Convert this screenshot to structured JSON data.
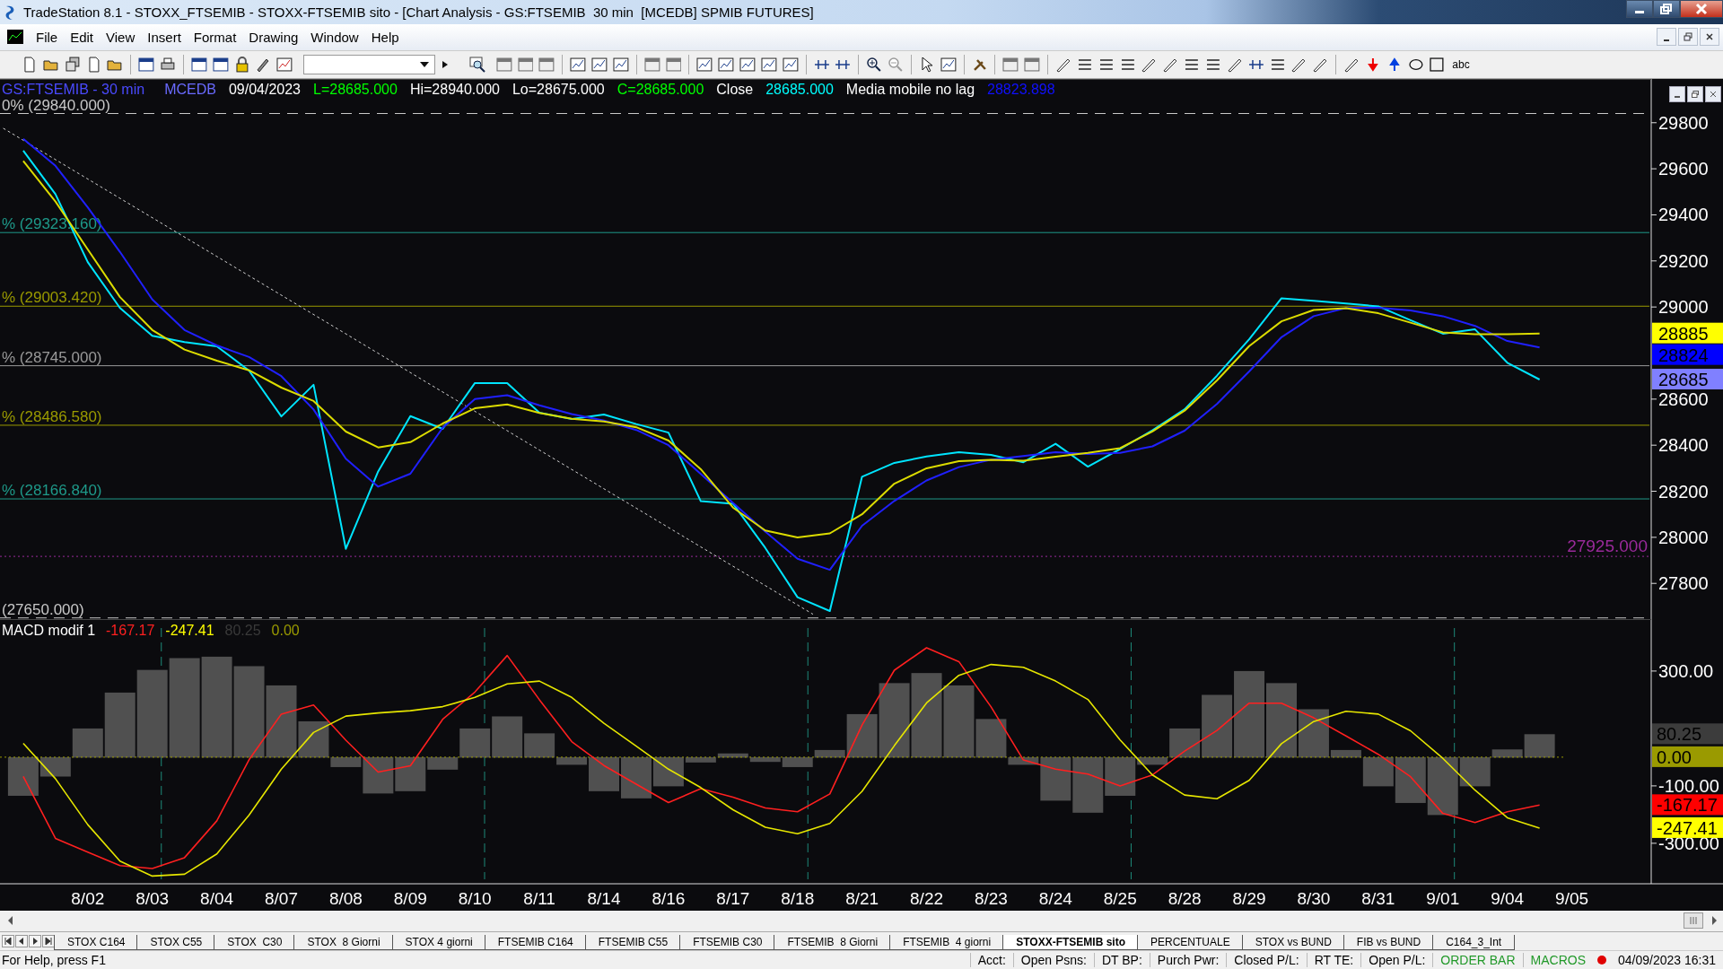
{
  "window": {
    "title": "TradeStation 8.1 - STOXX_FTSEMIB - STOXX-FTSEMIB sito - [Chart Analysis - GS:FTSEMIB  30 min  [MCEDB] SPMIB FUTURES]"
  },
  "menu": [
    "File",
    "Edit",
    "View",
    "Insert",
    "Format",
    "Drawing",
    "Window",
    "Help"
  ],
  "toolbar": {
    "text_tool": "abc"
  },
  "price_panel": {
    "header": [
      {
        "text": "GS:FTSEMIB - 30 min",
        "color": "#4a4aff"
      },
      {
        "text": "MCEDB",
        "color": "#6a6aff"
      },
      {
        "text": "09/04/2023",
        "color": "#ffffff"
      },
      {
        "text": "L=28685.000",
        "color": "#00ff00"
      },
      {
        "text": "Hi=28940.000",
        "color": "#ffffff"
      },
      {
        "text": "Lo=28675.000",
        "color": "#ffffff"
      },
      {
        "text": "C=28685.000",
        "color": "#00ff00"
      },
      {
        "text": "Close",
        "color": "#ffffff"
      },
      {
        "text": "28685.000",
        "color": "#00ffff"
      },
      {
        "text": "Media mobile no lag",
        "color": "#ffffff"
      },
      {
        "text": "28823.898",
        "color": "#1010ff"
      }
    ],
    "axis_badges": [
      {
        "label": "28885",
        "color": "#ffff00"
      },
      {
        "label": "28824",
        "color": "#0000ff"
      },
      {
        "label": "28685",
        "color": "#8080ff"
      }
    ],
    "chart_data": {
      "type": "line",
      "ylim": [
        27645,
        29990
      ],
      "yticks": [
        27800,
        28000,
        28200,
        28400,
        28600,
        29000,
        29200,
        29400,
        29600,
        29800
      ],
      "series": [
        {
          "color": "#00e5ff",
          "values": [
            29679,
            29490,
            29195,
            28996,
            28875,
            28848,
            28829,
            28724,
            28525,
            28662,
            27950,
            28286,
            28526,
            28471,
            28670,
            28670,
            28541,
            28514,
            28533,
            28492,
            28455,
            28157,
            28146,
            27954,
            27740,
            27680,
            28263,
            28323,
            28351,
            28370,
            28358,
            28326,
            28406,
            28307,
            28383,
            28465,
            28556,
            28702,
            28860,
            29038,
            29027,
            29015,
            29003,
            28943,
            28884,
            28903,
            28758,
            28685,
            null
          ]
        },
        {
          "color": "#2020ff",
          "values": [
            29730,
            29613,
            29432,
            29239,
            29033,
            28900,
            28833,
            28783,
            28700,
            28555,
            28341,
            28220,
            28276,
            28476,
            28600,
            28617,
            28573,
            28535,
            28507,
            28466,
            28400,
            28275,
            28150,
            28025,
            27907,
            27859,
            28050,
            28158,
            28247,
            28305,
            28337,
            28353,
            28370,
            28362,
            28367,
            28395,
            28463,
            28579,
            28720,
            28869,
            28960,
            28995,
            28997,
            28985,
            28960,
            28918,
            28852,
            28824,
            null
          ]
        },
        {
          "color": "#dcdc00",
          "values": [
            29634,
            29458,
            29250,
            29043,
            28900,
            28815,
            28767,
            28725,
            28650,
            28592,
            28459,
            28390,
            28413,
            28494,
            28560,
            28577,
            28540,
            28515,
            28503,
            28478,
            28420,
            28296,
            28129,
            28030,
            28000,
            28017,
            28100,
            28233,
            28300,
            28330,
            28337,
            28333,
            28350,
            28367,
            28387,
            28460,
            28550,
            28681,
            28830,
            28938,
            28987,
            28995,
            28973,
            28932,
            28890,
            28882,
            28882,
            28885,
            null
          ]
        }
      ],
      "ref_lines": [
        {
          "axis": "y",
          "value": 29840,
          "label": "0% (29840.000)",
          "color": "#c8c8c8"
        },
        {
          "axis": "y",
          "value": 29323.16,
          "label": "% (29323.160)",
          "color": "#1e9a8a"
        },
        {
          "axis": "y",
          "value": 29003.42,
          "label": "% (29003.420)",
          "color": "#9a9a00"
        },
        {
          "axis": "y",
          "value": 28745,
          "label": "% (28745.000)",
          "color": "#9a9a9a"
        },
        {
          "axis": "y",
          "value": 28486.58,
          "label": "% (28486.580)",
          "color": "#9a9a00"
        },
        {
          "axis": "y",
          "value": 28166.84,
          "label": "% (28166.840)",
          "color": "#1e9a8a"
        },
        {
          "axis": "y",
          "value": 27650,
          "label": "(27650.000)",
          "color": "#c8c8c8"
        },
        {
          "axis": "y",
          "value": 27925,
          "label": "27925.000",
          "color": "#9a2a9a"
        }
      ]
    }
  },
  "macd_panel": {
    "header": [
      {
        "text": "MACD modif 1",
        "color": "#ffffff"
      },
      {
        "text": "-167.17",
        "color": "#ff2020"
      },
      {
        "text": "-247.41",
        "color": "#ffff00"
      },
      {
        "text": "80.25",
        "color": "#3a3a3a"
      },
      {
        "text": "0.00",
        "color": "#9a9a00"
      }
    ],
    "axis_badges": [
      {
        "label": "80.25",
        "color": "#3c3c3c"
      },
      {
        "label": "0.00",
        "color": "#9a9a00"
      },
      {
        "label": "-167.17",
        "color": "#ff0000"
      },
      {
        "label": "-247.41",
        "color": "#ffff00"
      }
    ],
    "chart_data": {
      "type": "line",
      "ylim": [
        -441,
        481
      ],
      "categories": [
        null,
        null,
        "8/02",
        null,
        "8/03",
        null,
        "8/04",
        null,
        "8/07",
        null,
        "8/08",
        null,
        "8/09",
        null,
        "8/10",
        null,
        "8/11",
        null,
        "8/14",
        null,
        "8/16",
        null,
        "8/17",
        null,
        "8/18",
        null,
        "8/21",
        null,
        "8/22",
        null,
        "8/23",
        null,
        "8/24",
        null,
        "8/25",
        null,
        "8/28",
        null,
        "8/29",
        null,
        "8/30",
        null,
        "8/31",
        null,
        "9/01",
        null,
        "9/04",
        null,
        "9/05"
      ],
      "yticks": [
        {
          "value": 300,
          "label": "300.00"
        },
        {
          "value": -100,
          "label": "-100.00"
        },
        {
          "value": -300,
          "label": "-300.00"
        }
      ],
      "series": [
        {
          "type": "bar",
          "color": "#505050",
          "values": [
            -133,
            -66,
            100,
            225,
            304,
            345,
            350,
            317,
            250,
            125,
            -33,
            -125,
            -117,
            -42,
            100,
            142,
            83,
            -25,
            -117,
            -142,
            -100,
            -17,
            13,
            -15,
            -33,
            25,
            150,
            258,
            293,
            250,
            133,
            -25,
            -150,
            -192,
            -133,
            -25,
            100,
            217,
            300,
            258,
            167,
            25,
            -100,
            -158,
            -200,
            -100,
            27,
            80,
            null
          ]
        },
        {
          "type": "line",
          "color": "#ff2020",
          "values": [
            -67,
            -283,
            -331,
            -378,
            -388,
            -350,
            -222,
            -9,
            150,
            182,
            59,
            -52,
            -30,
            132,
            227,
            354,
            200,
            54,
            -29,
            -94,
            -158,
            -110,
            -139,
            -177,
            -190,
            -128,
            112,
            303,
            381,
            333,
            175,
            -10,
            -42,
            -59,
            -100,
            -62,
            21,
            93,
            188,
            188,
            137,
            74,
            10,
            -68,
            -196,
            -228,
            -190,
            -167,
            null
          ]
        },
        {
          "type": "line",
          "color": "#e6e600",
          "values": [
            48,
            -75,
            -235,
            -362,
            -414,
            -408,
            -337,
            -202,
            -42,
            86,
            143,
            154,
            162,
            176,
            208,
            255,
            265,
            208,
            118,
            38,
            -42,
            -106,
            -183,
            -244,
            -267,
            -231,
            -119,
            40,
            189,
            285,
            323,
            313,
            265,
            201,
            60,
            -62,
            -132,
            -145,
            -81,
            47,
            124,
            160,
            150,
            92,
            -4,
            -115,
            -211,
            -247,
            null
          ]
        }
      ],
      "ref_lines": [
        {
          "axis": "y",
          "value": 0,
          "color": "#9a9a00"
        }
      ]
    }
  },
  "sheet_tabs": [
    {
      "label": "STOX C164",
      "selected": false
    },
    {
      "label": "STOX C55",
      "selected": false
    },
    {
      "label": "STOX  C30",
      "selected": false
    },
    {
      "label": "STOX  8 Giorni",
      "selected": false
    },
    {
      "label": "STOX 4 giorni",
      "selected": false
    },
    {
      "label": "FTSEMIB C164",
      "selected": false
    },
    {
      "label": "FTSEMIB C55",
      "selected": false
    },
    {
      "label": "FTSEMIB C30",
      "selected": false
    },
    {
      "label": "FTSEMIB  8 Giorni",
      "selected": false
    },
    {
      "label": "FTSEMIB  4 giorni",
      "selected": false
    },
    {
      "label": "STOXX-FTSEMIB sito",
      "selected": true
    },
    {
      "label": "PERCENTUALE",
      "selected": false
    },
    {
      "label": "STOX vs BUND",
      "selected": false
    },
    {
      "label": "FIB vs BUND",
      "selected": false
    },
    {
      "label": "C164_3_Int",
      "selected": false
    }
  ],
  "status_bar": {
    "help": "For Help, press F1",
    "fields": [
      "Acct:",
      "Open Psns:",
      "DT BP:",
      "Purch Pwr:",
      "Closed P/L:",
      "RT TE:",
      "Open P/L:"
    ],
    "order_bar": "ORDER BAR",
    "macros": "MACROS",
    "datetime": "04/09/2023 16:31"
  }
}
